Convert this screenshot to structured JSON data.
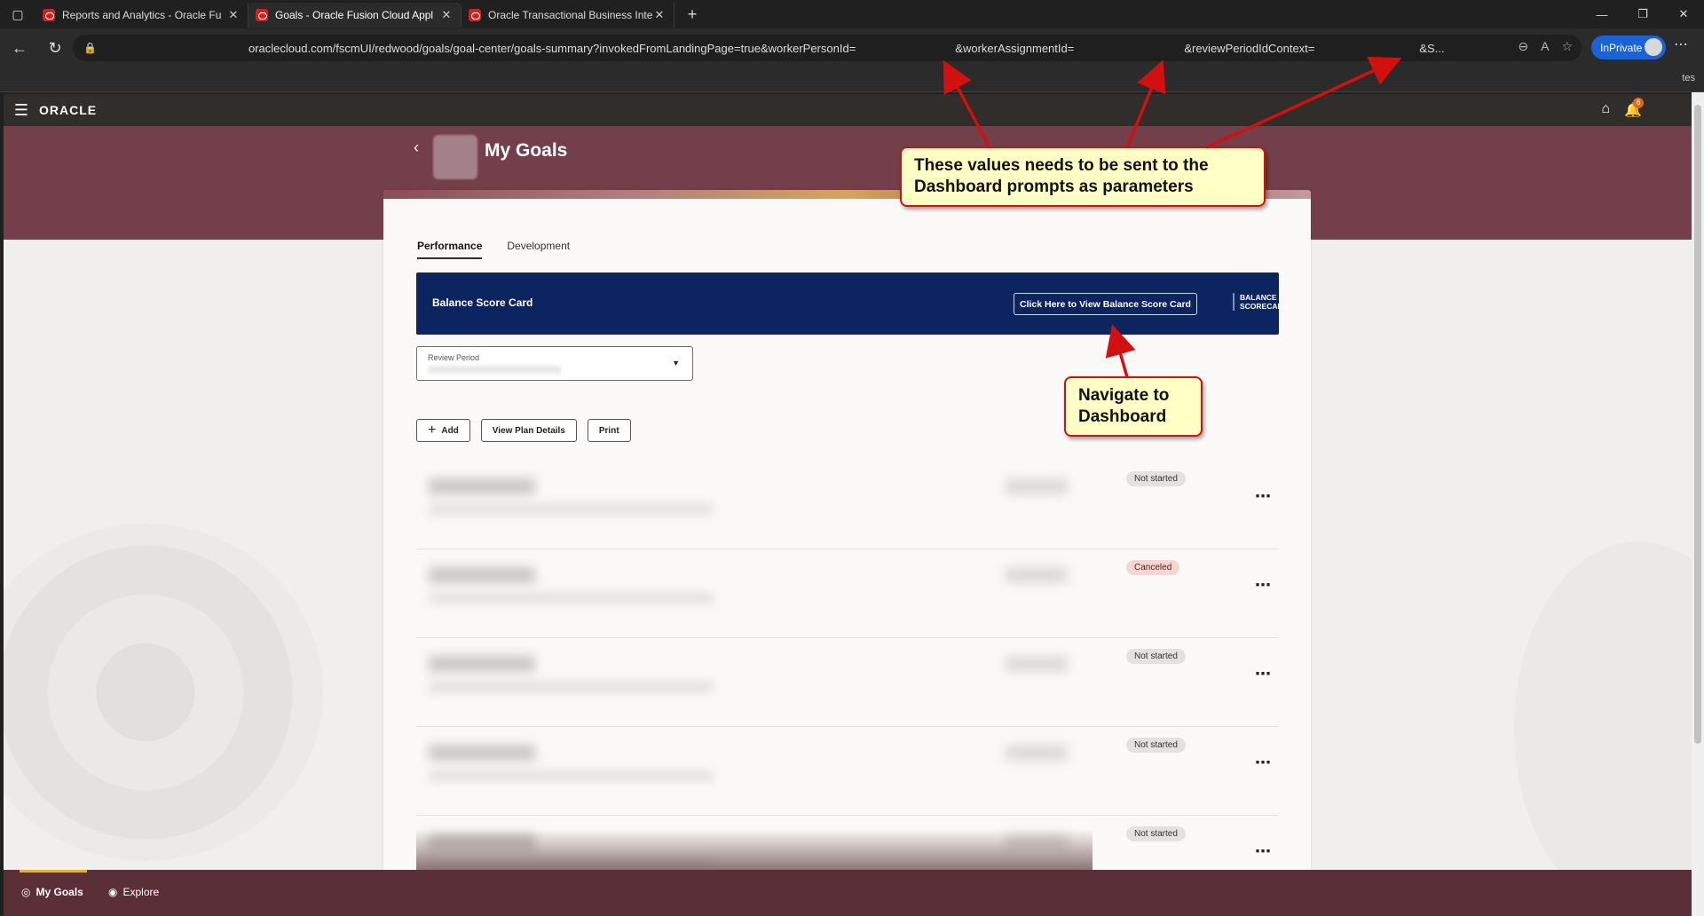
{
  "browser": {
    "tabs": [
      {
        "label": "Reports and Analytics - Oracle Fu",
        "active": false
      },
      {
        "label": "Goals - Oracle Fusion Cloud Appl",
        "active": true
      },
      {
        "label": "Oracle Transactional Business Inte",
        "active": false
      }
    ],
    "close_glyph": "✕",
    "new_tab_glyph": "+",
    "url_parts": {
      "p1": "oraclecloud.com/fscmUI/redwood/goals/goal-center/goals-summary?invokedFromLandingPage=true&workerPersonId=",
      "p2": "&workerAssignmentId=",
      "p3": "&reviewPeriodIdContext=",
      "p4": "&S..."
    },
    "inprivate_label": "InPrivate",
    "favbar_right": "tes"
  },
  "app": {
    "brand": "ORACLE",
    "notification_count": "6",
    "page_title": "My Goals"
  },
  "tabs": {
    "performance": "Performance",
    "development": "Development"
  },
  "bsc": {
    "title": "Balance Score Card",
    "button_label": "Click Here to View Balance Score Card",
    "logo_line1": "BALANCE",
    "logo_line2": "SCORECARD"
  },
  "review_period": {
    "label": "Review Period"
  },
  "actions": {
    "add": "Add",
    "view_plan": "View Plan Details",
    "print": "Print"
  },
  "goals": [
    {
      "status": "Not started",
      "status_type": "neutral"
    },
    {
      "status": "Canceled",
      "status_type": "danger"
    },
    {
      "status": "Not started",
      "status_type": "neutral"
    },
    {
      "status": "Not started",
      "status_type": "neutral"
    },
    {
      "status": "Not started",
      "status_type": "neutral"
    }
  ],
  "footer": {
    "my_goals": "My Goals",
    "explore": "Explore"
  },
  "callouts": {
    "params": "These values needs to be sent to the Dashboard prompts as parameters",
    "navigate": "Navigate to Dashboard"
  },
  "colors": {
    "banner": "#733f4a",
    "bsc_bg": "#0c2460",
    "footer": "#5b2f38",
    "callout_border": "#d21010",
    "callout_bg": "#ffffc6"
  }
}
